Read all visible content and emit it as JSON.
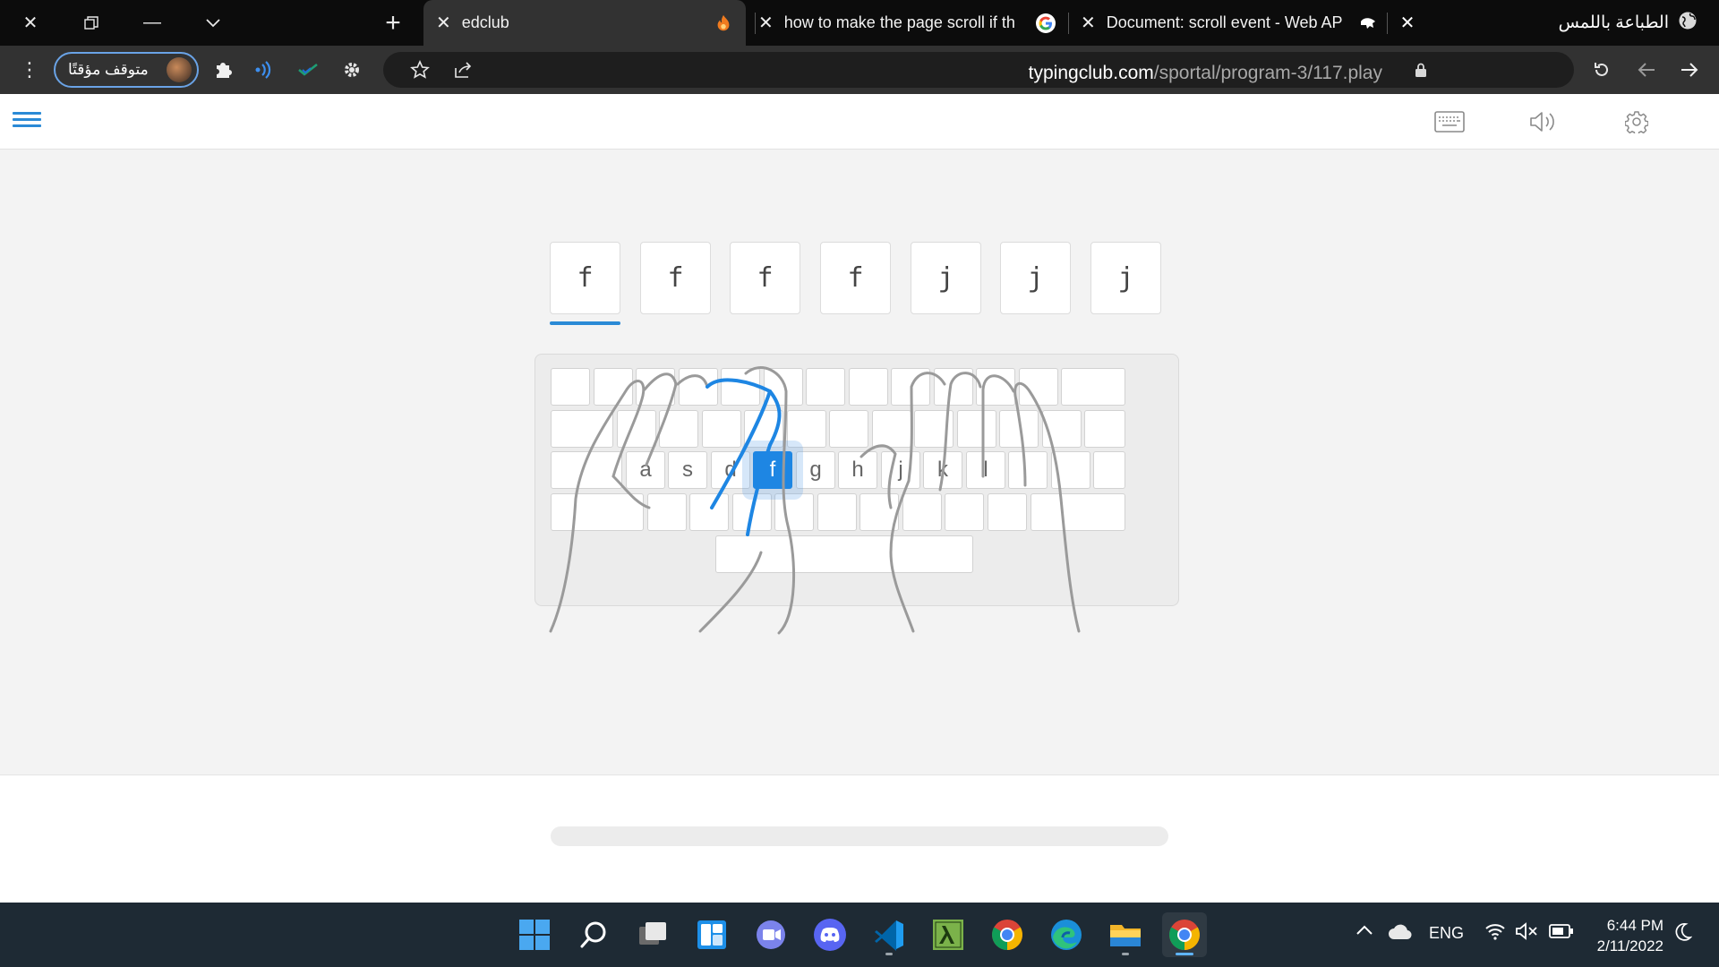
{
  "browser": {
    "tabs": [
      {
        "title": "edclub",
        "favicon": "edclub-flame-icon",
        "active": true
      },
      {
        "title": "how to make the page scroll if th",
        "favicon": "google-icon",
        "active": false
      },
      {
        "title": "Document: scroll event - Web AP",
        "favicon": "mdn-icon",
        "active": false
      }
    ],
    "new_tab_symbol": "+",
    "touch_typing_label": "الطباعة باللمس",
    "profile_label": "متوقف مؤقتًا",
    "url_host": "typingclub.com",
    "url_path": "/sportal/program-3/117.play"
  },
  "lesson": {
    "characters": [
      "f",
      "f",
      "f",
      "f",
      "j",
      "j",
      "j"
    ],
    "current_index": 0,
    "home_row_labels": [
      "a",
      "s",
      "d",
      "f",
      "g",
      "h",
      "j",
      "k",
      "l"
    ],
    "highlighted_key": "f",
    "progress_fraction": 0
  },
  "taskbar": {
    "apps": [
      "start-icon",
      "search-icon",
      "task-view-icon",
      "widgets-icon",
      "teams-chat-icon",
      "discord-icon",
      "vscode-icon",
      "lambda-app-icon",
      "chrome-icon",
      "edge-icon",
      "file-explorer-icon",
      "chrome-icon"
    ],
    "language": "ENG",
    "time": "6:44 PM",
    "date": "2/11/2022"
  },
  "colors": {
    "accent": "#2a8ad6",
    "active_key": "#1e86e3",
    "titlebar": "#0c0c0c",
    "toolbar": "#323232",
    "taskbar": "#1e2a34"
  }
}
